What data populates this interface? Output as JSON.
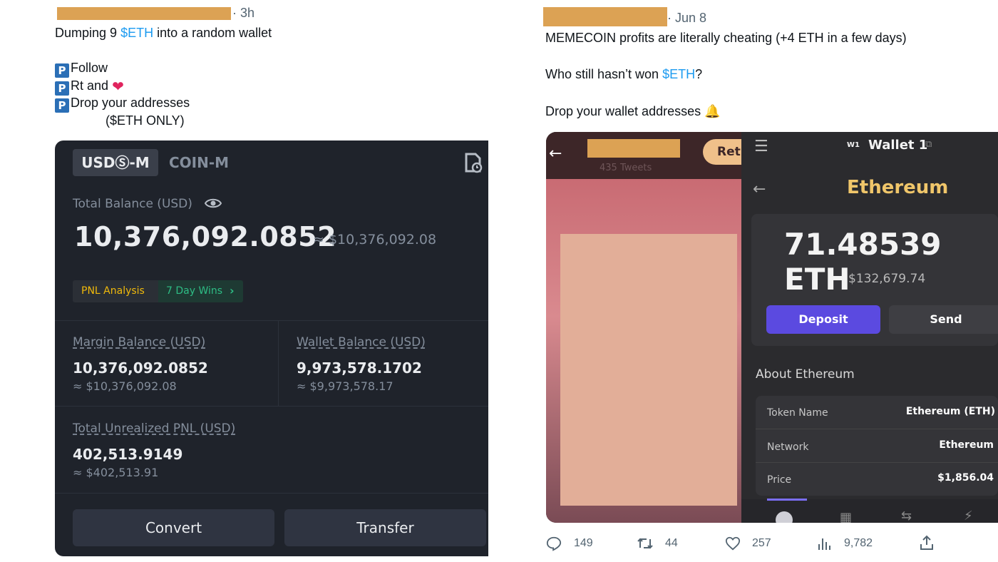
{
  "tweet_left": {
    "time": "· 3h",
    "line1_pre": "Dumping 9 ",
    "line1_link": "$ETH",
    "line1_post": " into a random wallet",
    "list": [
      {
        "badge": "P",
        "text": "Follow"
      },
      {
        "badge": "P",
        "text": "Rt and"
      },
      {
        "badge": "P",
        "text": "Drop your addresses"
      }
    ],
    "note": "($ETH ONLY)"
  },
  "exchange": {
    "tab_active": "USDⓈ-M",
    "tab_inactive": "COIN-M",
    "total_label": "Total Balance (USD)",
    "total_value": "10,376,092.0852",
    "total_approx": "≈ $10,376,092.08",
    "pnl_analysis": "PNL Analysis",
    "day_wins": "7 Day Wins",
    "margin_label": "Margin Balance (USD)",
    "margin_value": "10,376,092.0852",
    "margin_approx": "≈ $10,376,092.08",
    "wallet_label": "Wallet Balance (USD)",
    "wallet_value": "9,973,578.1702",
    "wallet_approx": "≈ $9,973,578.17",
    "upnl_label": "Total Unrealized PNL (USD)",
    "upnl_value": "402,513.9149",
    "upnl_approx": "≈ $402,513.91",
    "convert": "Convert",
    "transfer": "Transfer"
  },
  "tweet_right": {
    "time": "· Jun 8",
    "line1": "MEMECOIN profits are literally cheating (+4 ETH in a few days)",
    "line2_pre": "Who still hasn’t won ",
    "line2_link": "$ETH",
    "line2_post": "?",
    "line3": "Drop your wallet addresses"
  },
  "wallet": {
    "tweets_count": "435 Tweets",
    "ret": "Ret",
    "badge": "W1",
    "name": "Wallet 1",
    "title": "Ethereum",
    "balance": "71.48539 ETH",
    "usd": "$132,679.74",
    "deposit": "Deposit",
    "send": "Send",
    "about": "About Ethereum",
    "rows": [
      {
        "label": "Token Name",
        "value": "Ethereum (ETH)"
      },
      {
        "label": "Network",
        "value": "Ethereum"
      },
      {
        "label": "Price",
        "value": "$1,856.04"
      }
    ]
  },
  "stats": {
    "replies": "149",
    "retweets": "44",
    "likes": "257",
    "views": "9,782"
  },
  "colors": {
    "link": "#1d9bf0",
    "redaction": "#dca254",
    "exchange_bg": "#1f232b",
    "deposit": "#5b4ae0",
    "pnl_green": "#2ebd85",
    "pnl_gold": "#f0b90b"
  }
}
